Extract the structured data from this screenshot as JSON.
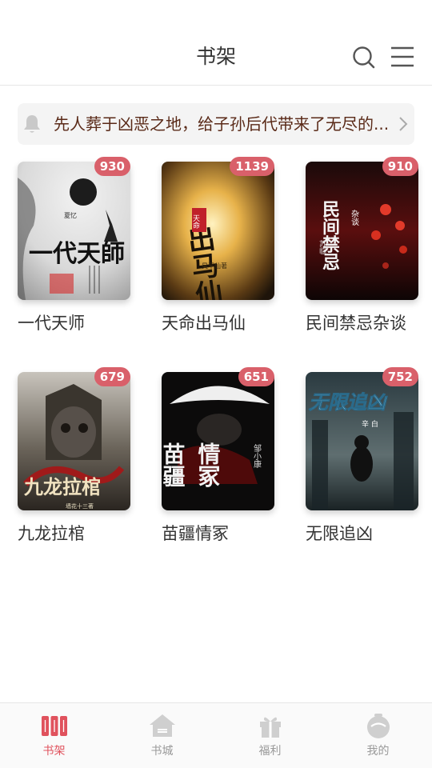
{
  "header": {
    "title": "书架",
    "search_icon": "search-icon",
    "menu_icon": "menu-icon"
  },
  "notice": {
    "icon": "bell-icon",
    "text": "先人葬于凶恶之地，给子孙后代带来了无尽的..."
  },
  "books": [
    {
      "title": "一代天师",
      "badge": "930"
    },
    {
      "title": "天命出马仙",
      "badge": "1139"
    },
    {
      "title": "民间禁忌杂谈",
      "badge": "910"
    },
    {
      "title": "九龙拉棺",
      "badge": "679"
    },
    {
      "title": "苗疆情冢",
      "badge": "651"
    },
    {
      "title": "无限追凶",
      "badge": "752"
    }
  ],
  "covers": {
    "c1_main": "一代天師",
    "c1_author": "夏忆",
    "c2_main": "出马仙",
    "c2_tag": "天命",
    "c2_author": "昊平仙著",
    "c3_main": "民间禁忌",
    "c3_tag": "杂谈",
    "c3_author": "苏临",
    "c4_main": "九龙拉棺",
    "c4_author": "墙花十三著",
    "c5_main1": "苗疆",
    "c5_main2": "情冢",
    "c5_author": "邹小康",
    "c6_main": "无限追凶",
    "c6_author": "辛 白"
  },
  "tabbar": {
    "tabs": [
      {
        "label": "书架",
        "icon": "bookshelf-icon",
        "active": true
      },
      {
        "label": "书城",
        "icon": "house-icon",
        "active": false
      },
      {
        "label": "福利",
        "icon": "gift-icon",
        "active": false
      },
      {
        "label": "我的",
        "icon": "profile-icon",
        "active": false
      }
    ],
    "active_color": "#e0525d",
    "inactive_color": "#999999"
  },
  "colors": {
    "badge": "#d9606a",
    "notice_text": "#5a2a18",
    "notice_bg": "#f4f4f4"
  }
}
